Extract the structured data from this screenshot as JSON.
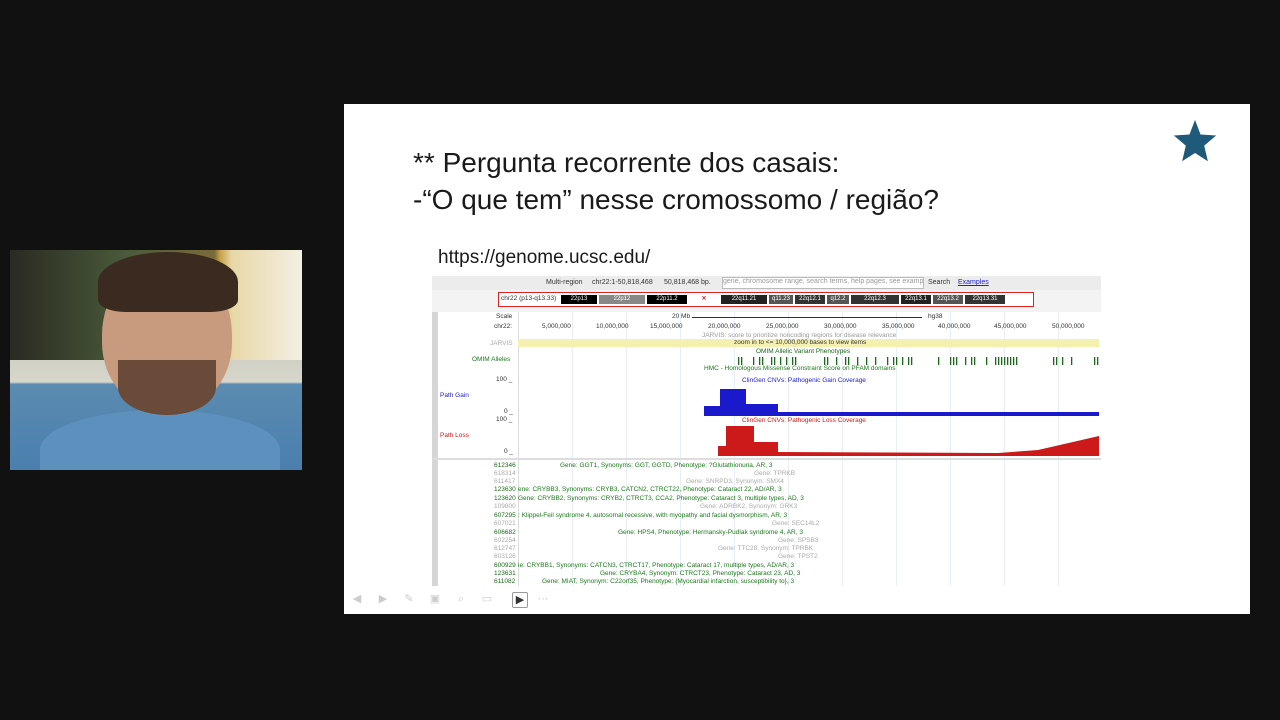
{
  "slide": {
    "title_line1": "** Pergunta recorrente dos casais:",
    "title_line2": "-“O que tem” nesse cromossomo / região?",
    "url": "https://genome.ucsc.edu/",
    "star_color": "#1f5a7a"
  },
  "ucsc": {
    "multi_region": "Multi-region",
    "position": "chr22:1-50,818,468",
    "size": "50,818,468 bp.",
    "search_placeholder": "gene, chromosome range, search terms, help pages, see examples",
    "search_button": "Search",
    "examples_link": "Examples",
    "ideogram_label": "chr22 (p13-q13.33)",
    "bands": [
      "22p13",
      "22p12",
      "22p11.2",
      "22q11.21",
      "q11.23",
      "22q12.1",
      "q12.2",
      "22q12.3",
      "22q13.1",
      "22q13.2",
      "22q13.31"
    ],
    "scale_label": "Scale",
    "chrom_label": "chr22:",
    "scale_bar": "20 Mb",
    "assembly": "hg38",
    "ticks": [
      "5,000,000",
      "10,000,000",
      "15,000,000",
      "20,000,000",
      "25,000,000",
      "30,000,000",
      "35,000,000",
      "40,000,000",
      "45,000,000",
      "50,000,000"
    ],
    "jarvis_label": "JARVIS",
    "jarvis_desc": "JARVIS: score to prioritize noncoding regions for disease relevance",
    "zoom_msg": "zoom in to <= 10,000,000 bases to view items",
    "omim_label": "OMIM Alleles",
    "omim_desc": "OMIM Allelic Variant Phenotypes",
    "hmc_desc": "HMC - Homologous Missense Constraint Score on PFAM domains",
    "path_gain_label": "Path Gain",
    "path_gain_desc": "ClinGen CNVs: Pathogenic Gain Coverage",
    "path_loss_label": "Path Loss",
    "path_loss_desc": "ClinGen CNVs: Pathogenic Loss Coverage",
    "axis_max": "100 _",
    "axis_min": "0 _",
    "gain_color": "#1a1acc",
    "loss_color": "#cc1a1a",
    "gene_ids": [
      "612346",
      "618314",
      "611417",
      "123630",
      "123620",
      "109800",
      "607295",
      "607021",
      "606682",
      "602254",
      "612747",
      "603126",
      "600929",
      "123631",
      "611082"
    ],
    "gene_lines": [
      "Gene: GGT1, Synonyms: GGT, GGTD, Phenotype: ?Glutathionuria, AR, 3",
      "Gene: TPRKB",
      "Gene: SNRPD3, Synonym: SMX4",
      "ene: CRYBB3, Synonyms: CRYB3, CATCN2, CTRCT22, Phenotype: Cataract 22, AD/AR, 3",
      "Gene: CRYBB2, Synonyms: CRYB2, CTRCT3, CCA2, Phenotype: Cataract 3, multiple types, AD, 3",
      "Gene: ADRBK2, Synonym: GRK3",
      ": Klippel-Feil syndrome 4, autosomal recessive, with myopathy and facial dysmorphism, AR, 3",
      "Gene: SEC14L2",
      "Gene: HPS4, Phenotype: Hermansky-Pudlak syndrome 4, AR, 3",
      "Gene: SPSB3",
      "Gene: TTC28, Synonym: TPRBK",
      "Gene: TPST2",
      "ie: CRYBB1, Synonyms: CATCN3, CTRCT17, Phenotype: Cataract 17, multiple types, AD/AR, 3",
      "Gene: CRYBA4, Synonym: CTRCT23, Phenotype: Cataract 23, AD, 3",
      "Gene: MIAT, Synonym: C22orf35, Phenotype: {Myocardial infarction, susceptibility to}, 3"
    ]
  },
  "toolbar": {
    "icons": [
      "prev-icon",
      "next-icon",
      "pen-icon",
      "highlighter-icon",
      "zoom-icon",
      "subtitles-icon",
      "camera-icon",
      "more-icon"
    ]
  }
}
